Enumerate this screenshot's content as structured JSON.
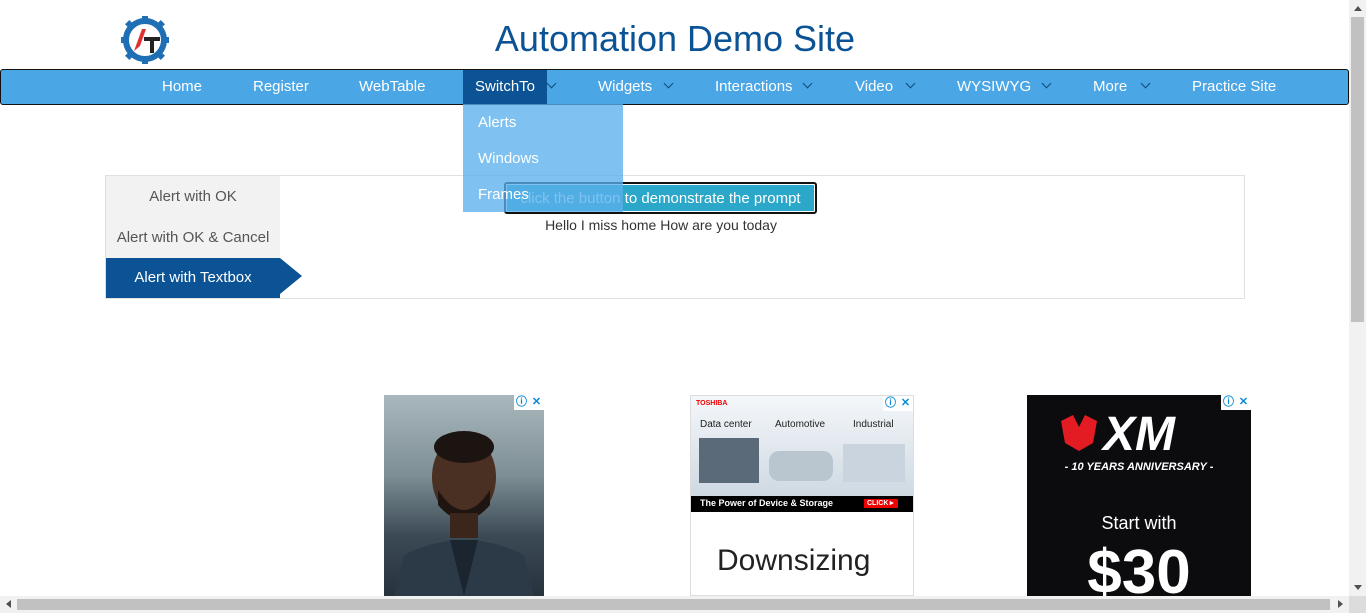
{
  "site": {
    "title": "Automation Demo Site"
  },
  "colors": {
    "brand": "#0b5394",
    "nav_bg": "#4ba6e6",
    "button": "#2aa7c9"
  },
  "nav": {
    "items": [
      {
        "label": "Home",
        "has_caret": false
      },
      {
        "label": "Register",
        "has_caret": false
      },
      {
        "label": "WebTable",
        "has_caret": false
      },
      {
        "label": "SwitchTo",
        "has_caret": true,
        "active": true
      },
      {
        "label": "Widgets",
        "has_caret": true
      },
      {
        "label": "Interactions",
        "has_caret": true
      },
      {
        "label": "Video",
        "has_caret": true
      },
      {
        "label": "WYSIWYG",
        "has_caret": true
      },
      {
        "label": "More",
        "has_caret": true
      },
      {
        "label": "Practice Site",
        "has_caret": false
      }
    ]
  },
  "dropdown": {
    "items": [
      "Alerts",
      "Windows",
      "Frames"
    ]
  },
  "tabs": [
    {
      "label": "Alert with OK"
    },
    {
      "label": "Alert with OK & Cancel"
    },
    {
      "label": "Alert with Textbox",
      "active": true
    }
  ],
  "main": {
    "button_label": "click the button to demonstrate the prompt box",
    "result_text": "Hello I miss home How are you today"
  },
  "ads": {
    "ad2": {
      "brand": "TOSHIBA",
      "cols": [
        "Data center",
        "Automotive",
        "Industrial"
      ],
      "tagline": "The Power of Device & Storage",
      "cta": "CLICK►",
      "headline": "Downsizing"
    },
    "ad3": {
      "brand": "XM",
      "sub": "- 10 YEARS ANNIVERSARY -",
      "line1": "Start with",
      "line2": "$30"
    },
    "badge_info": "ⓘ",
    "badge_close": "✕"
  }
}
